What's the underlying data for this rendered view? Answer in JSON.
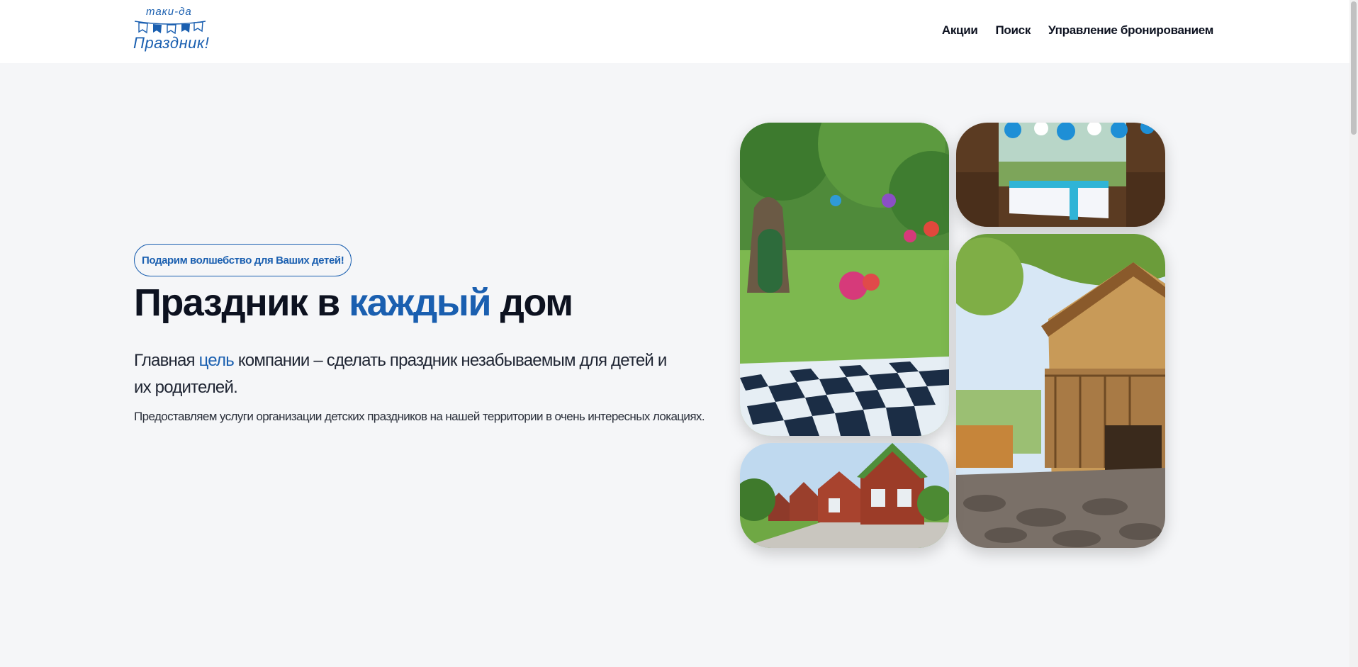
{
  "logo": {
    "top_text": "таки-да",
    "bottom_text": "Праздник!",
    "brand_color": "#1a5fb0"
  },
  "nav": {
    "items": [
      "Акции",
      "Поиск",
      "Управление бронированием"
    ]
  },
  "hero": {
    "badge": "Подарим волшебство для Ваших детей!",
    "title_part1": "Праздник в ",
    "title_accent": "каждый",
    "title_part2": " дом",
    "lead_part1": "Главная ",
    "lead_accent": "цель",
    "lead_part2": " компании – сделать праздник незабываемым для детей и их родителей.",
    "sub": "Предоставляем услуги организации детских праздников на нашей территории в очень интересных локациях."
  },
  "colors": {
    "accent": "#1a5fb0",
    "text": "#0d1220",
    "background": "#f5f6f8"
  }
}
